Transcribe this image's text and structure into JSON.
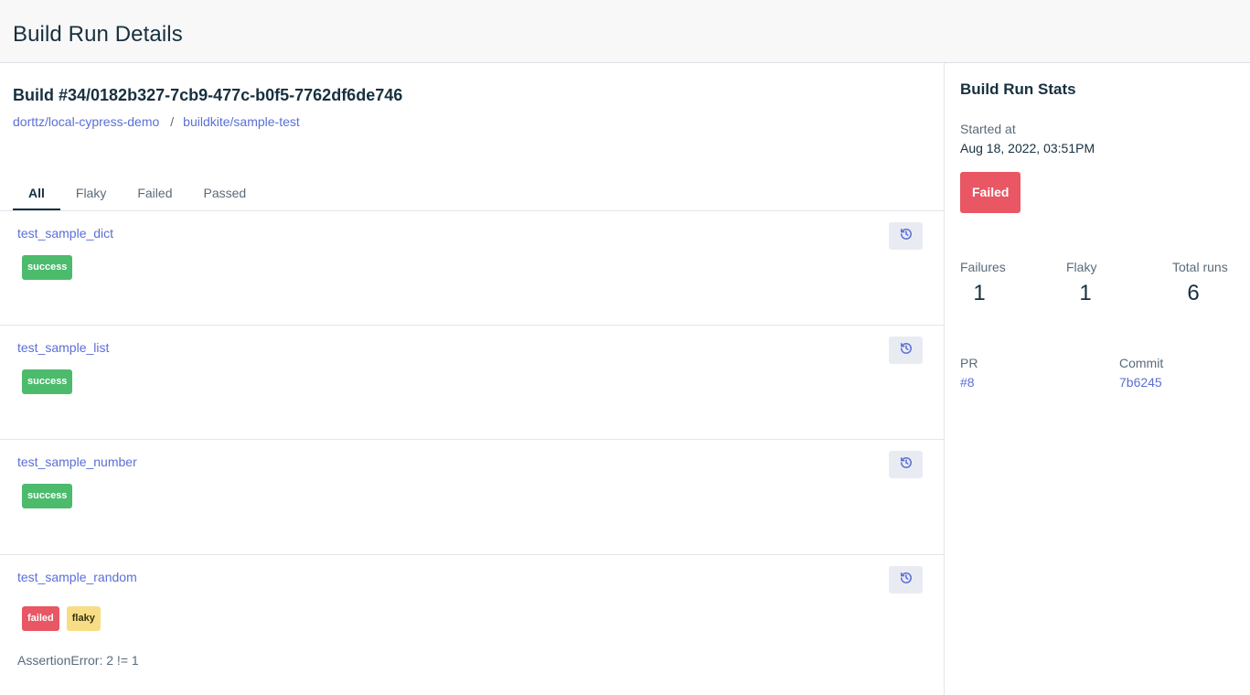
{
  "header": {
    "title": "Build Run Details"
  },
  "build": {
    "title": "Build #34/0182b327-7cb9-477c-b0f5-7762df6de746",
    "breadcrumb": [
      "dorttz/local-cypress-demo",
      "buildkite/sample-test"
    ],
    "breadcrumb_separator": "/"
  },
  "tabs": [
    "All",
    "Flaky",
    "Failed",
    "Passed"
  ],
  "active_tab": "All",
  "tests": [
    {
      "name": "test_sample_dict",
      "badges": [
        {
          "label": "success"
        }
      ],
      "history_icon": "history-icon"
    },
    {
      "name": "test_sample_list",
      "badges": [
        {
          "label": "success"
        }
      ],
      "history_icon": "history-icon"
    },
    {
      "name": "test_sample_number",
      "badges": [
        {
          "label": "success"
        }
      ],
      "history_icon": "history-icon"
    },
    {
      "name": "test_sample_random",
      "badges": [
        {
          "label": "failed"
        },
        {
          "label": "flaky"
        }
      ],
      "error": "AssertionError: 2 != 1",
      "history_icon": "history-icon"
    }
  ],
  "stats": {
    "title": "Build Run Stats",
    "started_label": "Started at",
    "started_value": "Aug 18, 2022, 03:51PM",
    "status": "Failed",
    "failures_label": "Failures",
    "failures_value": "1",
    "flaky_label": "Flaky",
    "flaky_value": "1",
    "total_label": "Total runs",
    "total_value": "6",
    "pr_label": "PR",
    "pr_value": "#8",
    "commit_label": "Commit",
    "commit_value": "7b6245"
  },
  "colors": {
    "accent_link": "#5a6fd6",
    "success": "#4cbb6c",
    "failed": "#e85763",
    "flaky": "#f7de86",
    "text_dark": "#17303f"
  }
}
